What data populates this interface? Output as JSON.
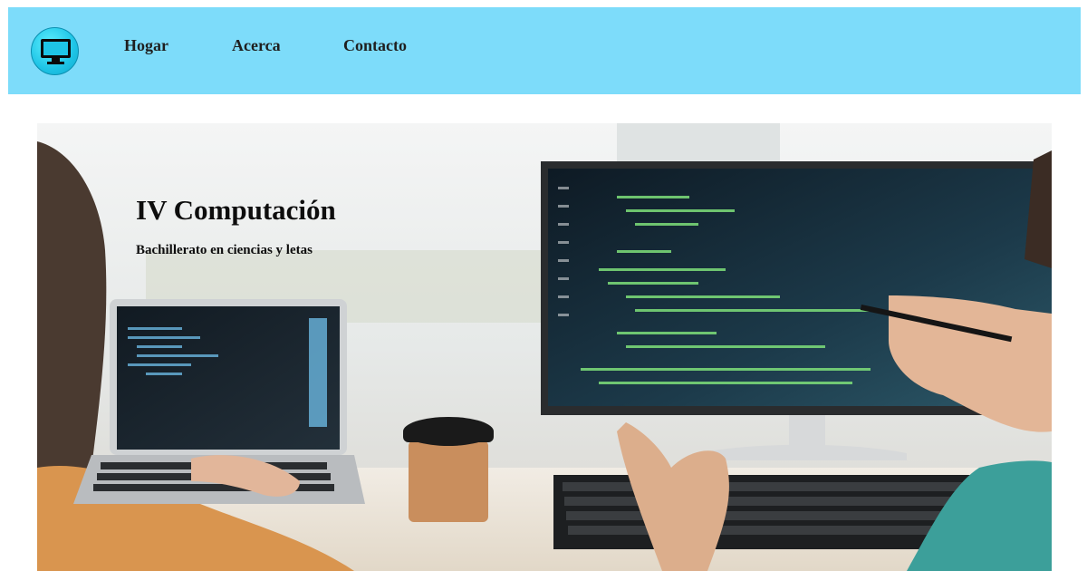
{
  "navbar": {
    "logo_icon": "monitor-icon",
    "links": [
      {
        "label": "Hogar"
      },
      {
        "label": "Acerca"
      },
      {
        "label": "Contacto"
      }
    ],
    "background_color": "#7ddcfa"
  },
  "hero": {
    "title": "IV Computación",
    "subtitle": "Bachillerato en ciencias y letas",
    "image_description_icon": "developers-working-photo"
  }
}
